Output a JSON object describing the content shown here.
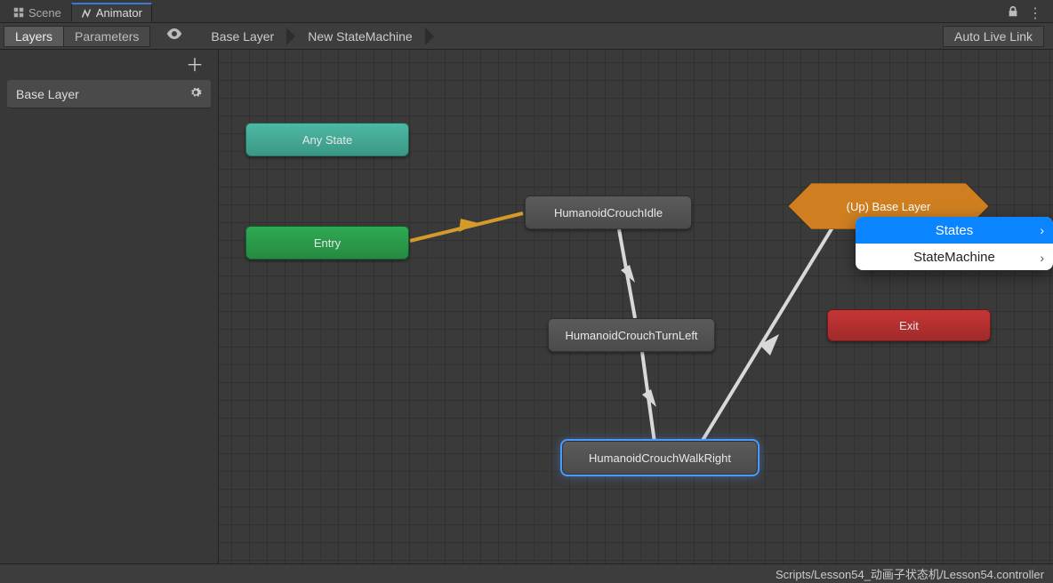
{
  "tabs": {
    "scene": "Scene",
    "animator": "Animator"
  },
  "subbar": {
    "layers": "Layers",
    "parameters": "Parameters",
    "autolive": "Auto Live Link"
  },
  "breadcrumbs": [
    "Base Layer",
    "New StateMachine"
  ],
  "sidebar": {
    "layer0": "Base Layer"
  },
  "nodes": {
    "anystate": "Any State",
    "entry": "Entry",
    "idle": "HumanoidCrouchIdle",
    "turnleft": "HumanoidCrouchTurnLeft",
    "walkright": "HumanoidCrouchWalkRight",
    "exit": "Exit",
    "up_base": "(Up) Base Layer"
  },
  "contextmenu": {
    "states": "States",
    "statemachine": "StateMachine"
  },
  "footer": "Scripts/Lesson54_动画子状态机/Lesson54.controller"
}
